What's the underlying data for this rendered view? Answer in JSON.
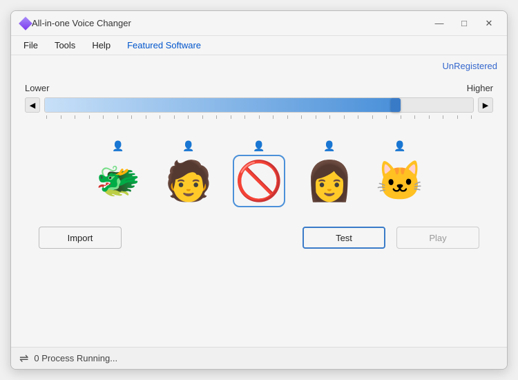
{
  "window": {
    "title": "All-in-one Voice Changer",
    "controls": {
      "minimize": "—",
      "maximize": "□",
      "close": "✕"
    }
  },
  "menu": {
    "items": [
      {
        "id": "file",
        "label": "File"
      },
      {
        "id": "tools",
        "label": "Tools"
      },
      {
        "id": "help",
        "label": "Help"
      },
      {
        "id": "featured",
        "label": "Featured Software",
        "highlight": true
      }
    ]
  },
  "content": {
    "unregistered_label": "UnRegistered",
    "slider": {
      "lower_label": "Lower",
      "higher_label": "Higher",
      "value": 82
    },
    "voices": [
      {
        "id": "dragon",
        "emoji": "🐲",
        "label": "Dragon"
      },
      {
        "id": "man",
        "emoji": "🧑",
        "label": "Man"
      },
      {
        "id": "none",
        "emoji": "🚫",
        "label": "None",
        "selected": true
      },
      {
        "id": "woman",
        "emoji": "👩",
        "label": "Woman"
      },
      {
        "id": "cat",
        "emoji": "🐱",
        "label": "Cat"
      }
    ],
    "buttons": {
      "import": "Import",
      "test": "Test",
      "play": "Play"
    }
  },
  "status": {
    "icon": "⇌",
    "text": "0 Process Running..."
  }
}
